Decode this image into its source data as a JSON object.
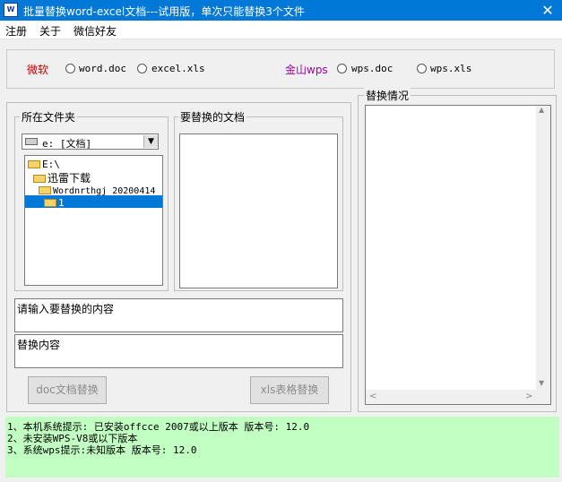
{
  "window": {
    "title": "批量替换word-excel文档---试用版，单次只能替换3个文件",
    "app_icon_text": "W",
    "close_glyph": "✕"
  },
  "menu": [
    "注册",
    "关于",
    "微信好友"
  ],
  "vendors": {
    "microsoft_label": "微软",
    "microsoft_color": "#c00000",
    "word_label": "word.doc",
    "excel_label": "excel.xls",
    "wps_label": "金山wps",
    "wps_color": "#a000a0",
    "wps_doc_label": "wps.doc",
    "wps_xls_label": "wps.xls"
  },
  "folder_group": {
    "title": "所在文件夹",
    "drive_value": "e: [文档]",
    "tree": [
      "E:\\",
      "迅雷下载",
      "Wordnrthgj_20200414",
      "1"
    ],
    "selected_index": 3
  },
  "docs_group": {
    "title": "要替换的文档"
  },
  "inputs": {
    "find_value": "请输入要替换的内容",
    "replace_value": "替换内容"
  },
  "buttons": {
    "doc_replace": "doc文档替换",
    "xls_replace": "xls表格替换"
  },
  "result_group": {
    "title": "替换情况"
  },
  "status": [
    "1、本机系统提示: 已安装offcce 2007或以上版本 版本号: 12.0",
    "2、未安装WPS-V8或以下版本",
    "3、系统wps提示:未知版本 版本号: 12.0"
  ]
}
